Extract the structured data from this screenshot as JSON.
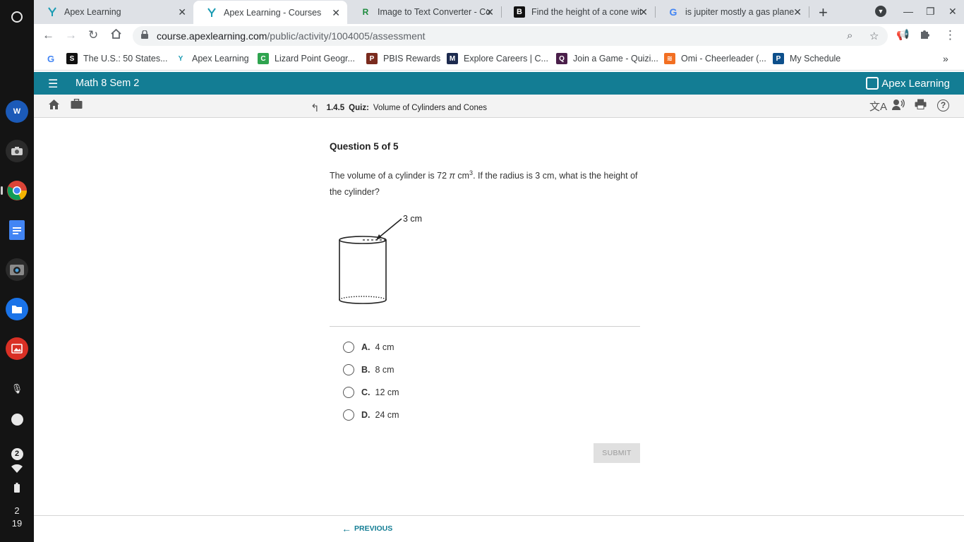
{
  "shelf": {
    "tray_count": "2",
    "time_hour": "2",
    "time_minute": "19"
  },
  "tabs": [
    {
      "title": "Apex Learning"
    },
    {
      "title": "Apex Learning - Courses"
    },
    {
      "title": "Image to Text Converter - Co"
    },
    {
      "title": "Find the height of a cone wit"
    },
    {
      "title": "is jupiter mostly a gas plane"
    }
  ],
  "toolbar": {
    "url_host": "course.apexlearning.com",
    "url_path": "/public/activity/1004005/assessment"
  },
  "bookmarks": [
    {
      "label": "The U.S.: 50 States..."
    },
    {
      "label": "Apex Learning"
    },
    {
      "label": "Lizard Point Geogr..."
    },
    {
      "label": "PBIS Rewards"
    },
    {
      "label": "Explore Careers | C..."
    },
    {
      "label": "Join a Game - Quizi..."
    },
    {
      "label": "Omi - Cheerleader (..."
    },
    {
      "label": "My Schedule"
    }
  ],
  "apex": {
    "course_title": "Math 8 Sem 2",
    "logo_text": "Apex Learning"
  },
  "breadcrumb": {
    "number": "1.4.5",
    "kind": "Quiz:",
    "name": "Volume of Cylinders and Cones"
  },
  "question": {
    "title": "Question 5 of 5",
    "text_part1": "The volume of a cylinder is 72 ",
    "pi": "π",
    "unit": " cm",
    "exponent": "3",
    "text_part2": ". If the radius is 3 cm, what is the height of the cylinder?",
    "figure_label": "3 cm"
  },
  "choices": [
    {
      "letter": "A.",
      "text": "4 cm"
    },
    {
      "letter": "B.",
      "text": "8 cm"
    },
    {
      "letter": "C.",
      "text": "12 cm"
    },
    {
      "letter": "D.",
      "text": "24 cm"
    }
  ],
  "submit_label": "SUBMIT",
  "previous_label": "PREVIOUS",
  "colors": {
    "apex_teal": "#137d94",
    "tabstrip": "#dee1e6",
    "shelf": "#141414"
  }
}
